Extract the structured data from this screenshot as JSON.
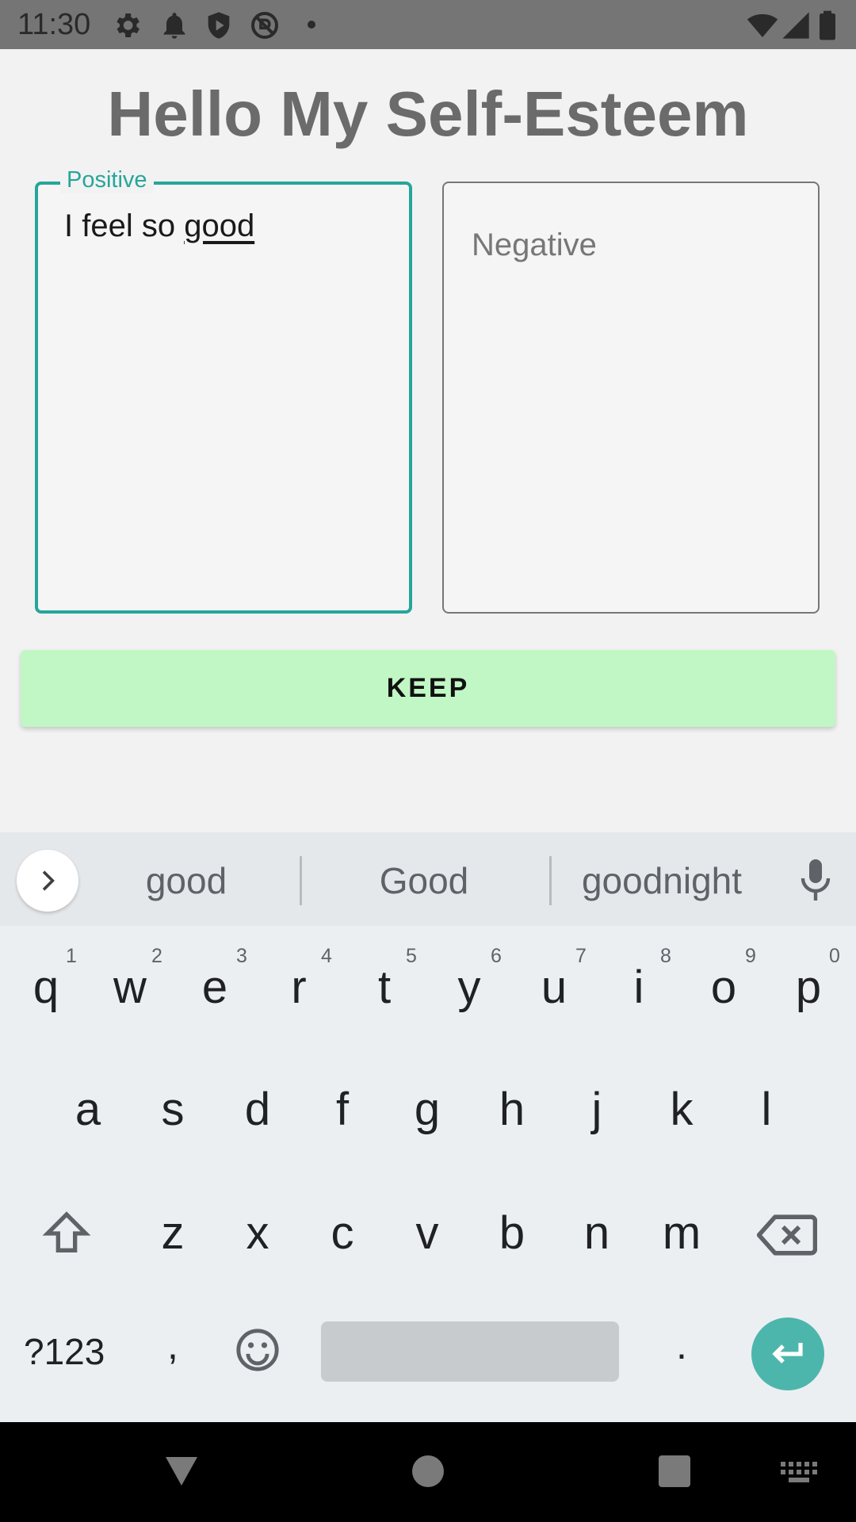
{
  "status_bar": {
    "time": "11:30",
    "icons": [
      "settings-icon",
      "notification-bell-icon",
      "shield-play-icon",
      "no-disturb-icon",
      "wifi-icon",
      "signal-icon",
      "battery-icon"
    ]
  },
  "page": {
    "title": "Hello My Self-Esteem"
  },
  "positive_field": {
    "label": "Positive",
    "value_prefix": "I feel so ",
    "value_composing": "good"
  },
  "negative_field": {
    "placeholder": "Negative"
  },
  "keep_button": {
    "label": "KEEP"
  },
  "keyboard": {
    "suggestions": [
      "good",
      "Good",
      "goodnight"
    ],
    "row1": [
      "q",
      "w",
      "e",
      "r",
      "t",
      "y",
      "u",
      "i",
      "o",
      "p"
    ],
    "row1_hints": [
      "1",
      "2",
      "3",
      "4",
      "5",
      "6",
      "7",
      "8",
      "9",
      "0"
    ],
    "row2": [
      "a",
      "s",
      "d",
      "f",
      "g",
      "h",
      "j",
      "k",
      "l"
    ],
    "row3": [
      "z",
      "x",
      "c",
      "v",
      "b",
      "n",
      "m"
    ],
    "symbols_label": "?123",
    "comma": ",",
    "period": "."
  },
  "colors": {
    "accent": "#26a69a",
    "keep_button_bg": "#c1f7c4",
    "enter_key": "#4db6ac",
    "status_bar": "#757575"
  }
}
